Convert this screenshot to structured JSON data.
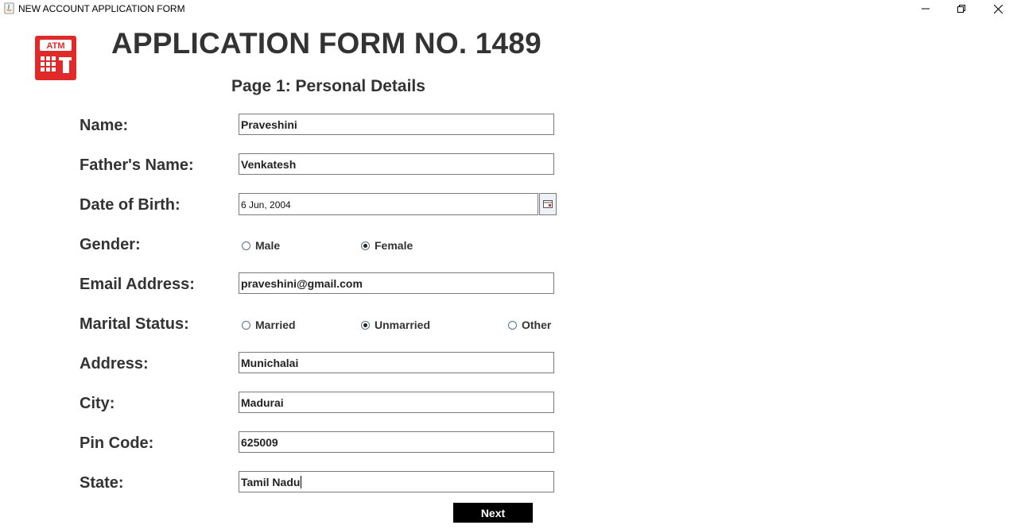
{
  "window": {
    "title": "NEW ACCOUNT APPLICATION FORM"
  },
  "logo": {
    "text": "ATM",
    "color": "#e02a2a"
  },
  "header": {
    "form_title": "APPLICATION FORM NO. 1489",
    "page_title": "Page 1: Personal Details"
  },
  "fields": {
    "name": {
      "label": "Name:",
      "value": "Praveshini"
    },
    "father_name": {
      "label": "Father's Name:",
      "value": "Venkatesh"
    },
    "dob": {
      "label": "Date of Birth:",
      "value": "6 Jun, 2004",
      "button_icon": "calendar-icon"
    },
    "gender": {
      "label": "Gender:",
      "options": [
        "Male",
        "Female"
      ],
      "selected": "Female"
    },
    "email": {
      "label": "Email Address:",
      "value": "praveshini@gmail.com"
    },
    "marital": {
      "label": "Marital Status:",
      "options": [
        "Married",
        "Unmarried",
        "Other"
      ],
      "selected": "Unmarried"
    },
    "address": {
      "label": "Address:",
      "value": "Munichalai"
    },
    "city": {
      "label": "City:",
      "value": "Madurai"
    },
    "pincode": {
      "label": "Pin Code:",
      "value": "625009"
    },
    "state": {
      "label": "State:",
      "value": "Tamil Nadu"
    }
  },
  "actions": {
    "next_label": "Next"
  }
}
